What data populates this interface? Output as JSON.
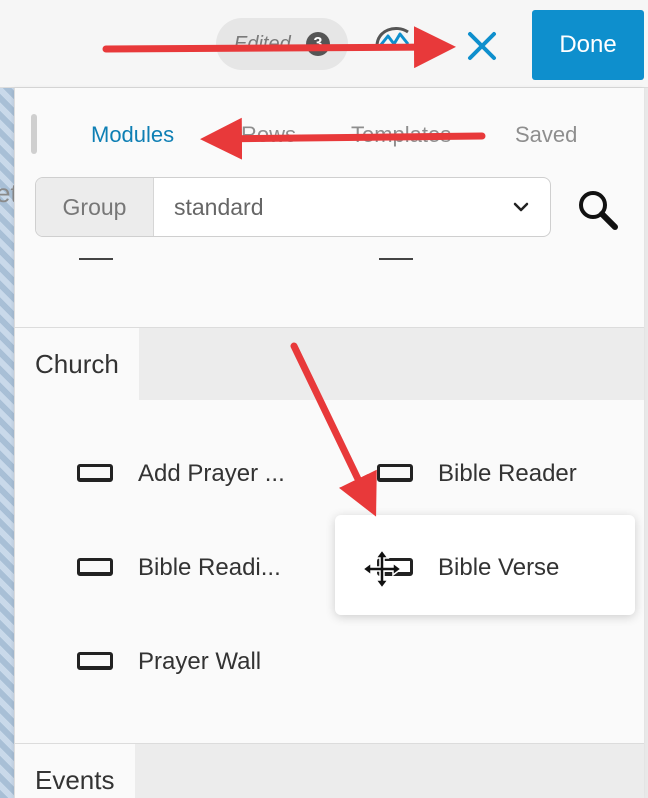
{
  "topbar": {
    "edited_label": "Edited",
    "edited_count": "3",
    "done_label": "Done"
  },
  "background": {
    "partial_text": "et"
  },
  "panel": {
    "tabs": [
      {
        "label": "Modules",
        "active": true
      },
      {
        "label": "Rows",
        "active": false
      },
      {
        "label": "Templates",
        "active": false
      },
      {
        "label": "Saved",
        "active": false
      }
    ],
    "group": {
      "label": "Group",
      "value": "standard"
    },
    "sections": [
      {
        "title": "Church",
        "modules": [
          {
            "label": "Add Prayer ..."
          },
          {
            "label": "Bible Reader"
          },
          {
            "label": "Bible Readi..."
          },
          {
            "label": "Bible Verse"
          },
          {
            "label": "Prayer Wall"
          }
        ]
      },
      {
        "title": "Events",
        "modules": []
      }
    ]
  },
  "colors": {
    "accent": "#0e8fcd",
    "active_tab": "#0e7fb4",
    "annotation_arrow": "#e8393a"
  },
  "icons": [
    "logo-icon",
    "close-icon",
    "chevron-down-icon",
    "search-icon",
    "module-icon",
    "move-cursor-icon"
  ]
}
